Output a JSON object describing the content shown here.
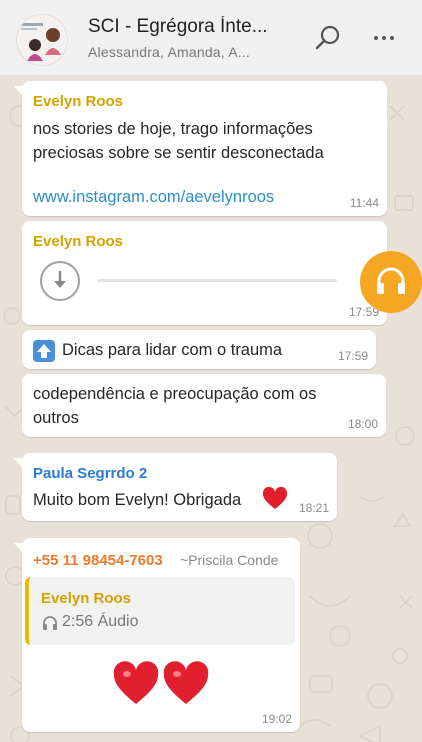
{
  "header": {
    "title": "SCI - Egrégora Ínte...",
    "participants": "Alessandra, Amanda, A..."
  },
  "messages": [
    {
      "sender": "Evelyn Roos",
      "sender_color": "#d4a100",
      "line1": "nos stories de hoje, trago informações",
      "line2": "preciosas sobre se sentir desconectada",
      "link": "www.instagram.com/aevelynroos",
      "time": "11:44"
    },
    {
      "sender": "Evelyn Roos",
      "sender_color": "#d4a100",
      "type": "voice-download",
      "time": "17:59"
    },
    {
      "emoji_label": "Dicas para lidar com o trauma",
      "time": "17:59"
    },
    {
      "line1": "codependência e preocupação com os",
      "line2": "outros",
      "time": "18:00"
    },
    {
      "sender": "Paula Segrrdo 2",
      "sender_color": "#2a7bd3",
      "text": "Muito bom Evelyn! Obrigada",
      "time": "18:21"
    },
    {
      "sender": "+55 11 98454-7603",
      "sender_color": "#f0792b",
      "push_name": "~Priscila Conde",
      "quote": {
        "sender": "Evelyn Roos",
        "sender_color": "#d4a100",
        "text": "2:56 Áudio"
      },
      "time": "19:02"
    }
  ]
}
